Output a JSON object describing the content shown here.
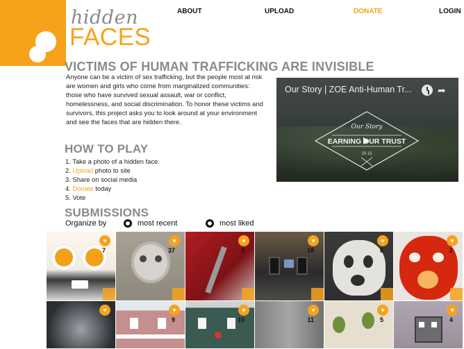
{
  "logo": {
    "line1": "hidden",
    "line2": "FACES",
    "brand_color": "#f7a21b",
    "gray": "#8a8a8a"
  },
  "nav": {
    "about": "ABOUT",
    "upload": "UPLOAD",
    "donate": "DONATE",
    "login": "LOGIN"
  },
  "headline": "VICTIMS OF HUMAN TRAFFICKING ARE INVISIBLE",
  "intro": "Anyone can be a victim of sex trafficking, but the people most at risk are women and girls who come from marginalized communities: those who have survived sexual assault, war or conflict, homelessness, and social discrimination. To honor these victims and survivors, this project asks you to look around at your environment and see the faces that are hidden there.",
  "how_to_play": {
    "title": "HOW TO PLAY",
    "steps": [
      {
        "num": "1.",
        "link": "",
        "text": "Take a photo of a hidden face."
      },
      {
        "num": "2.",
        "link": "Upload",
        "text": "photo to site"
      },
      {
        "num": "3.",
        "link": "",
        "text": "Share on social media"
      },
      {
        "num": "4.",
        "link": "Donate",
        "text": "today"
      },
      {
        "num": "5.",
        "link": "",
        "text": "Vote"
      }
    ]
  },
  "video": {
    "title": "Our Story | ZOE Anti-Human Tr...",
    "badge_script": "Our Story",
    "badge_main": "EARNING OUR TRUST",
    "badge_year": "20 15",
    "icons": [
      "clock-icon",
      "share-icon",
      "play-icon"
    ]
  },
  "submissions": {
    "title": "SUBMISSIONS",
    "organize_label": "Organize by",
    "options": [
      "most recent",
      "most liked"
    ],
    "selected": "most recent",
    "tiles": [
      {
        "count": "7",
        "subject": "eggs"
      },
      {
        "count": "37",
        "subject": "alarm-clock"
      },
      {
        "count": "3",
        "subject": "red-zipper"
      },
      {
        "count": "18",
        "subject": "stereo"
      },
      {
        "count": "6",
        "subject": "leaf-skull"
      },
      {
        "count": "2",
        "subject": "pepper"
      },
      {
        "count": "",
        "subject": "metal-lid"
      },
      {
        "count": "9",
        "subject": "pink-house"
      },
      {
        "count": "10",
        "subject": "green-house"
      },
      {
        "count": "11",
        "subject": "wall"
      },
      {
        "count": "5",
        "subject": "green-hooks"
      },
      {
        "count": "4",
        "subject": "box-face"
      }
    ]
  }
}
